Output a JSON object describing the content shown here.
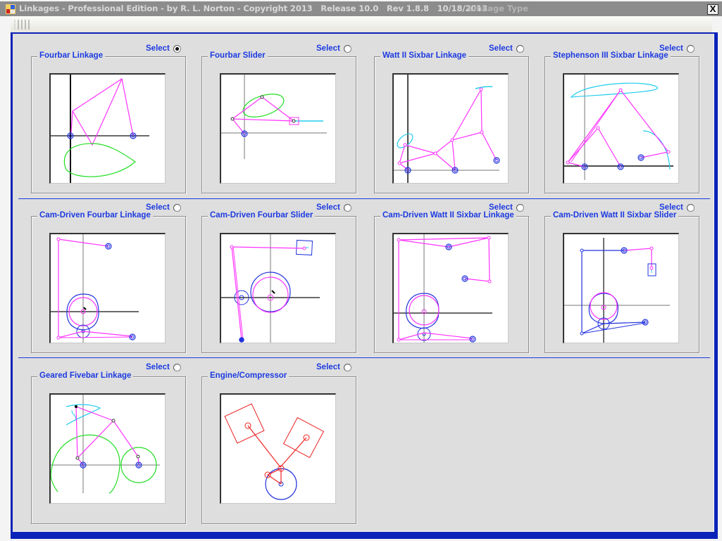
{
  "window": {
    "title": "Linkages - Professional Edition - by R. L. Norton - Copyright 2013   Release 10.0   Rev 1.8.8   10/18/2013",
    "subtitle": "Linkage Type",
    "close_label": "X",
    "app_icon": "app-icon"
  },
  "colors": {
    "frame": "#0a22b8",
    "label_blue": "#1c3ae0",
    "link_magenta": "#ff33ff",
    "pivot_blue": "#2233dd",
    "coupler_green": "#22dd22",
    "path_cyan": "#22ccee",
    "engine_red": "#ee2222"
  },
  "select_label": "Select",
  "linkage_types": [
    {
      "name": "Fourbar Linkage",
      "selected": true
    },
    {
      "name": "Fourbar Slider",
      "selected": false
    },
    {
      "name": "Watt II Sixbar Linkage",
      "selected": false
    },
    {
      "name": "Stephenson III Sixbar Linkage",
      "selected": false
    },
    {
      "name": "Cam-Driven Fourbar Linkage",
      "selected": false
    },
    {
      "name": "Cam-Driven Fourbar Slider",
      "selected": false
    },
    {
      "name": "Cam-Driven Watt II Sixbar Linkage",
      "selected": false
    },
    {
      "name": "Cam-Driven Watt II Sixbar Slider",
      "selected": false
    },
    {
      "name": "Geared Fivebar Linkage",
      "selected": false
    },
    {
      "name": "Engine/Compressor",
      "selected": false
    }
  ]
}
